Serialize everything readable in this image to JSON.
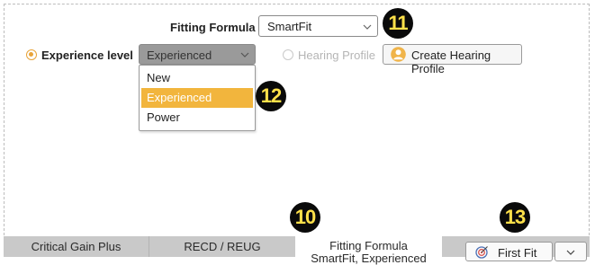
{
  "fitting_formula": {
    "label": "Fitting Formula",
    "selected": "SmartFit"
  },
  "experience": {
    "radio_selected": true,
    "label": "Experience level",
    "selected": "Experienced",
    "options": [
      "New",
      "Experienced",
      "Power"
    ],
    "highlighted_option": "Experienced"
  },
  "hearing_profile": {
    "label": "Hearing Profile",
    "enabled": false
  },
  "create_button": {
    "label": "Create Hearing Profile",
    "icon": "person-icon"
  },
  "tabs": [
    {
      "label": "Critical Gain Plus"
    },
    {
      "label": "RECD / REUG"
    },
    {
      "label": "Fitting Formula",
      "sub": "SmartFit, Experienced"
    }
  ],
  "first_fit": {
    "label": "First Fit",
    "icon": "target-icon"
  },
  "callouts": [
    "11",
    "12",
    "10",
    "13"
  ],
  "colors": {
    "accent": "#f2b53d",
    "callout_bg": "#0a0a0a",
    "callout_text": "#ffe14a",
    "tab_bg": "#c9c9c9"
  }
}
